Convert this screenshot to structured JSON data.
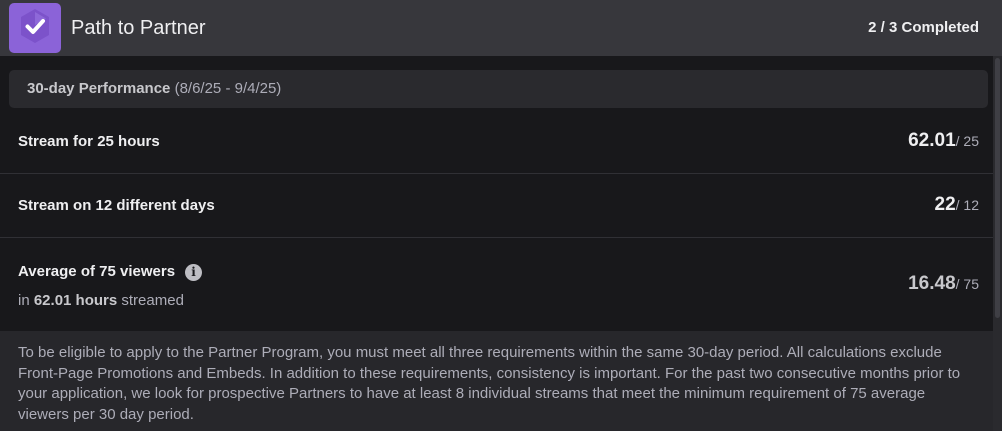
{
  "header": {
    "title": "Path to Partner",
    "status": "2 / 3 Completed",
    "badge_icon": "checkmark-icon",
    "badge_color": "#8b63d8"
  },
  "period": {
    "label": "30-day Performance",
    "range": "(8/6/25 - 9/4/25)"
  },
  "requirements": [
    {
      "label": "Stream for 25 hours",
      "current": "62.01",
      "target": "/ 25",
      "met": true
    },
    {
      "label": "Stream on 12 different days",
      "current": "22",
      "target": "/ 12",
      "met": true
    },
    {
      "label": "Average of 75 viewers",
      "info_icon": "info-icon",
      "sub_prefix": "in ",
      "sub_hours": "62.01 hours",
      "sub_suffix": " streamed",
      "current": "16.48",
      "target": "/ 75",
      "met": false
    }
  ],
  "footer": {
    "text": "To be eligible to apply to the Partner Program, you must meet all three requirements within the same 30-day period. All calculations exclude Front-Page Promotions and Embeds. In addition to these requirements, consistency is important. For the past two consecutive months prior to your application, we look for prospective Partners to have at least 8 individual streams that meet the minimum requirement of 75 average viewers per 30 day period."
  }
}
